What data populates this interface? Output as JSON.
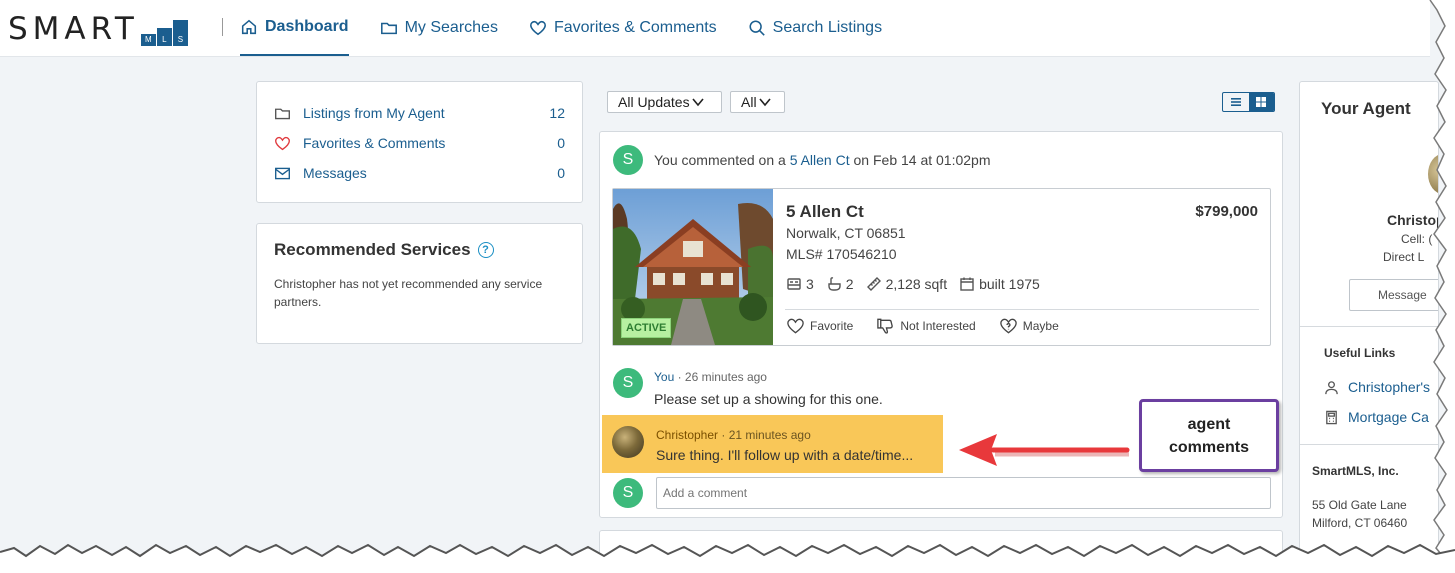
{
  "logo": {
    "text": "SMART",
    "mls": [
      "M",
      "L",
      "S"
    ]
  },
  "nav": [
    {
      "label": "Dashboard",
      "icon": "home-icon",
      "active": true
    },
    {
      "label": "My Searches",
      "icon": "folder-icon"
    },
    {
      "label": "Favorites & Comments",
      "icon": "heart-icon"
    },
    {
      "label": "Search Listings",
      "icon": "search-icon"
    }
  ],
  "summary": [
    {
      "label": "Listings from My Agent",
      "count": "12",
      "icon": "folder-icon"
    },
    {
      "label": "Favorites & Comments",
      "count": "0",
      "icon": "heart-icon"
    },
    {
      "label": "Messages",
      "count": "0",
      "icon": "envelope-icon"
    }
  ],
  "recommended": {
    "title": "Recommended Services",
    "help": "?",
    "text": "Christopher has not yet recommended any service partners."
  },
  "filters": {
    "updates": "All Updates",
    "scope": "All"
  },
  "feed": {
    "activity": {
      "avatar": "S",
      "prefix": "You commented on a ",
      "link": "5 Allen Ct",
      "suffix": " on Feb 14 at 01:02pm"
    },
    "listing": {
      "address": "5 Allen Ct",
      "price": "$799,000",
      "city": "Norwalk, CT 06851",
      "mls": "MLS# 170546210",
      "beds": "3",
      "baths": "2",
      "sqft": "2,128 sqft",
      "built": "built 1975",
      "status": "ACTIVE",
      "actions": [
        "Favorite",
        "Not Interested",
        "Maybe"
      ]
    },
    "comments": [
      {
        "avatar": "S",
        "author": "You",
        "time": " · 26 minutes ago",
        "text": "Please set up a showing for this one."
      },
      {
        "author": "Christopher",
        "time": " · 21 minutes ago",
        "text": "Sure thing. I'll follow up with a date/time..."
      }
    ],
    "input_avatar": "S",
    "input_placeholder": "Add a comment"
  },
  "annotation": {
    "line1": "agent",
    "line2": "comments",
    "border_color": "#6b3fa0",
    "arrow_color": "#e8383b",
    "highlight_color": "#f9c758"
  },
  "agent_panel": {
    "title": "Your Agent",
    "name": "Christop",
    "cell": "Cell: (",
    "direct": "Direct L",
    "message_button": "Message",
    "useful_links_title": "Useful Links",
    "links": [
      {
        "label": "Christopher's",
        "icon": "person-icon"
      },
      {
        "label": "Mortgage Ca",
        "icon": "calculator-icon"
      }
    ],
    "company": "SmartMLS, Inc.",
    "address1": "55 Old Gate Lane",
    "address2": "Milford, CT 06460"
  },
  "colors": {
    "brand": "#1b5e8f",
    "avatar_green": "#3dba7c",
    "active_badge": "#b7f0a1"
  }
}
